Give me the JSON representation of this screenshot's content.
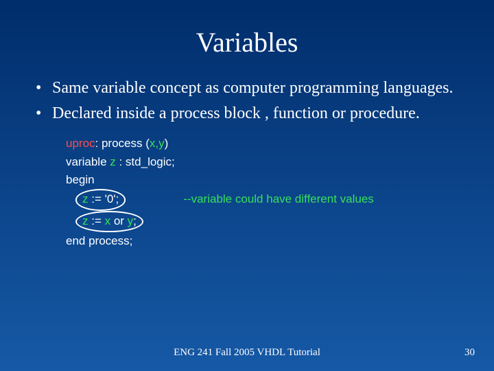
{
  "title": "Variables",
  "bullets": [
    "Same variable concept as computer programming languages.",
    "Declared inside a process block , function or procedure."
  ],
  "code": {
    "line1_proc": "uproc",
    "line1_mid": ": process (",
    "line1_args": "x,y",
    "line1_end": ")",
    "line2_a": "variable ",
    "line2_var": "z",
    "line2_b": " : std_logic;",
    "line3": "begin",
    "line4_var": "z",
    "line4_rest": " := '0';",
    "line4_comment": "--variable could have different values",
    "line5_var": "z",
    "line5_a": " := ",
    "line5_x": "x",
    "line5_or": " or ",
    "line5_y": "y",
    "line5_end": ";",
    "line6": "end process;"
  },
  "footer": "ENG 241 Fall 2005 VHDL Tutorial",
  "page": "30"
}
